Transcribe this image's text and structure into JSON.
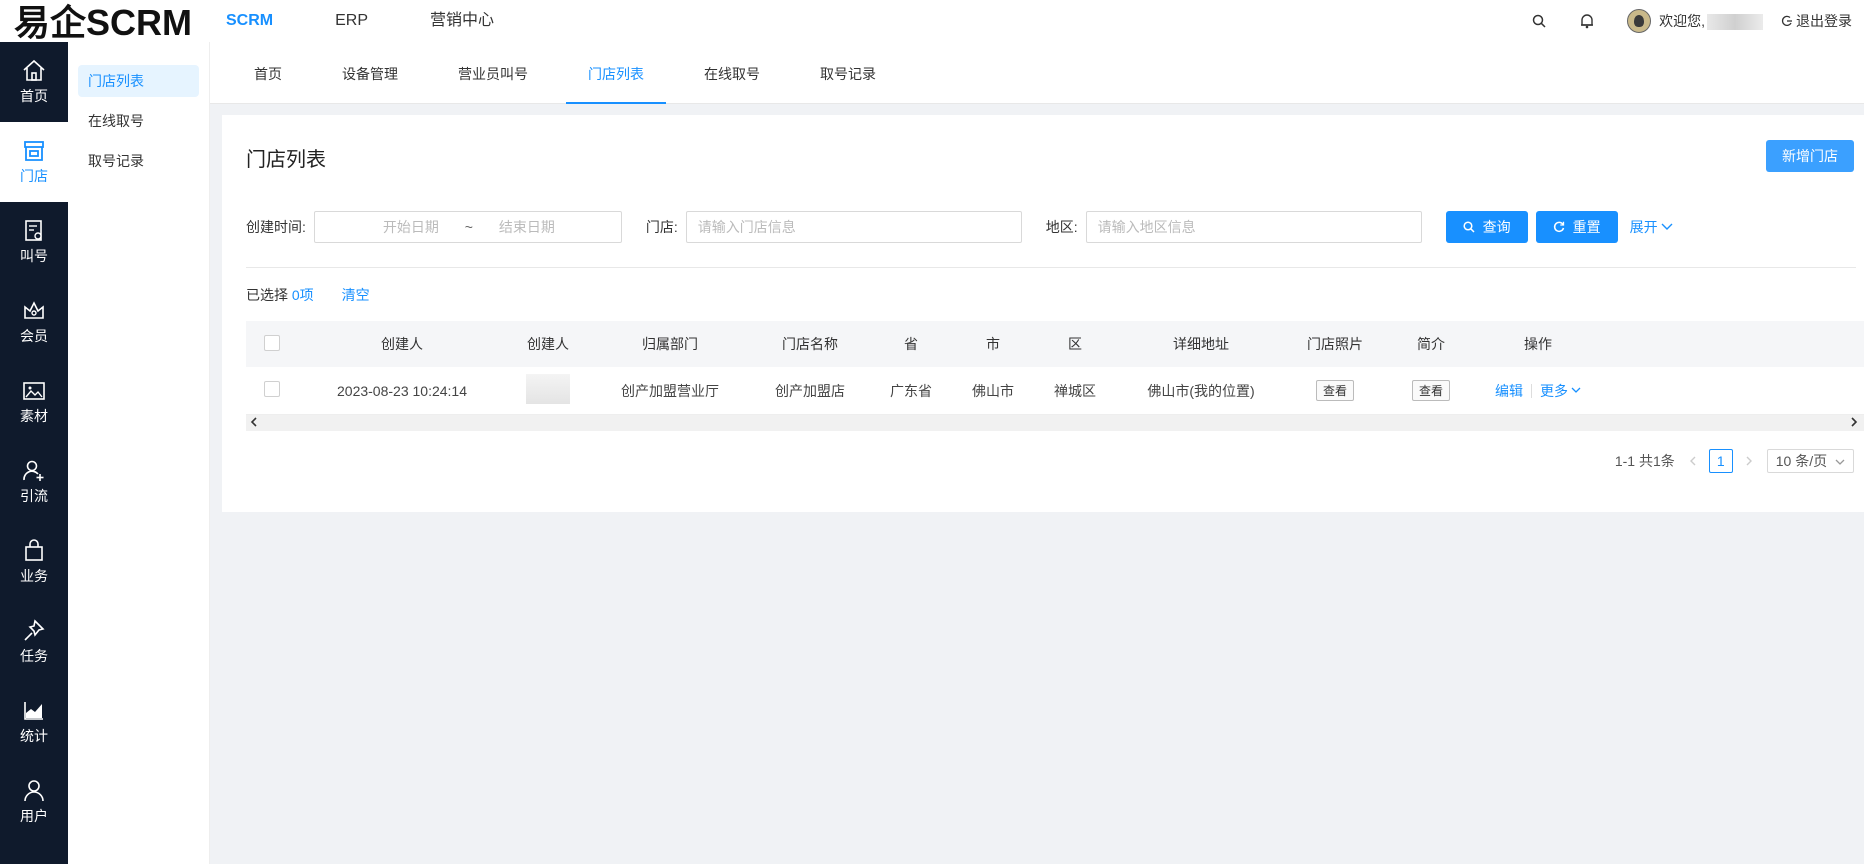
{
  "app": {
    "logo": "易企SCRM",
    "topnav": [
      "SCRM",
      "ERP",
      "营销中心"
    ],
    "welcome": "欢迎您,",
    "logout": "退出登录"
  },
  "sidebar": [
    {
      "label": "首页",
      "icon": "home-icon"
    },
    {
      "label": "门店",
      "icon": "store-icon"
    },
    {
      "label": "叫号",
      "icon": "queue-icon"
    },
    {
      "label": "会员",
      "icon": "crown-icon"
    },
    {
      "label": "素材",
      "icon": "image-icon"
    },
    {
      "label": "引流",
      "icon": "user-add-icon"
    },
    {
      "label": "业务",
      "icon": "bag-icon"
    },
    {
      "label": "任务",
      "icon": "pin-icon"
    },
    {
      "label": "统计",
      "icon": "chart-icon"
    },
    {
      "label": "用户",
      "icon": "user-icon"
    }
  ],
  "submenu": [
    "门店列表",
    "在线取号",
    "取号记录"
  ],
  "tabs": [
    "首页",
    "设备管理",
    "营业员叫号",
    "门店列表",
    "在线取号",
    "取号记录"
  ],
  "page": {
    "title": "门店列表",
    "new_button": "新增门店"
  },
  "filters": {
    "created_label": "创建时间:",
    "start_placeholder": "开始日期",
    "tilde": "~",
    "end_placeholder": "结束日期",
    "store_label": "门店:",
    "store_placeholder": "请输入门店信息",
    "region_label": "地区:",
    "region_placeholder": "请输入地区信息",
    "query": "查询",
    "reset": "重置",
    "expand": "展开"
  },
  "selection": {
    "prefix": "已选择",
    "count": "0项",
    "clear": "清空"
  },
  "table": {
    "headers": [
      "创建人",
      "创建人",
      "归属部门",
      "门店名称",
      "省",
      "市",
      "区",
      "详细地址",
      "门店照片",
      "简介",
      "操作"
    ],
    "rows": [
      {
        "created": "2023-08-23 10:24:14",
        "dept": "创产加盟营业厅",
        "store": "创产加盟店",
        "province": "广东省",
        "city": "佛山市",
        "district": "禅城区",
        "address": "佛山市(我的位置)",
        "photo_btn": "查看",
        "intro_btn": "查看",
        "edit": "编辑",
        "more": "更多"
      }
    ]
  },
  "pagination": {
    "summary": "1-1 共1条",
    "current": "1",
    "page_size": "10 条/页"
  }
}
